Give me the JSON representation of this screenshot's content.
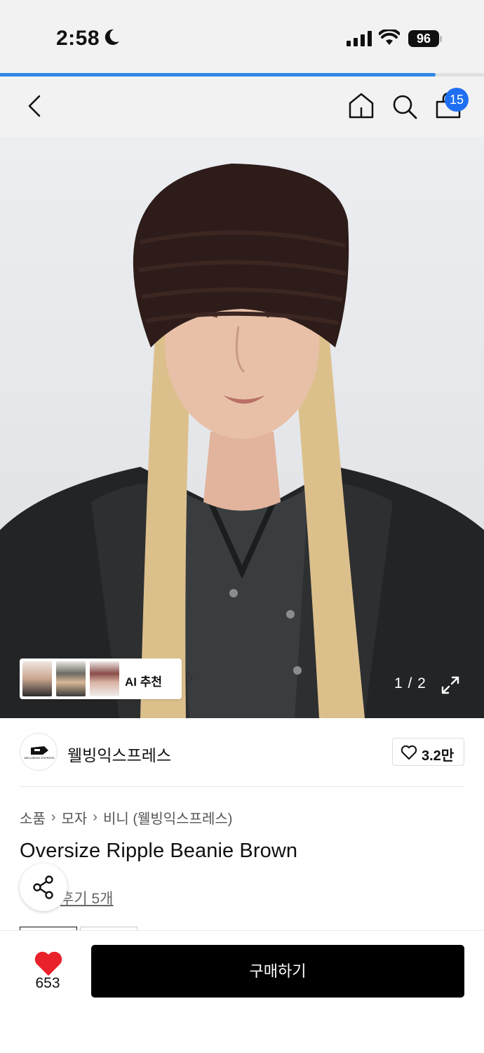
{
  "status_bar": {
    "time": "2:58",
    "battery": "96"
  },
  "page_progress": 0.9,
  "nav": {
    "cart_count": "15"
  },
  "hero": {
    "ai_label": "AI 추천",
    "page_indicator": "1 / 2"
  },
  "brand": {
    "name": "웰빙익스프레스",
    "logo_text": "WELLBEING EXPRESS",
    "like_count": "3.2만"
  },
  "breadcrumb": [
    "소품",
    "모자",
    "비니 (웰빙익스프레스)"
  ],
  "product": {
    "title": "Oversize Ripple Beanie Brown",
    "review_link": "후기 5개"
  },
  "bottom_bar": {
    "heart_count": "653",
    "buy_label": "구매하기"
  },
  "colors": {
    "accent_blue": "#2f86e8",
    "badge_blue": "#1f6ff2",
    "heart_red": "#e8212a",
    "buy_black": "#000000"
  }
}
